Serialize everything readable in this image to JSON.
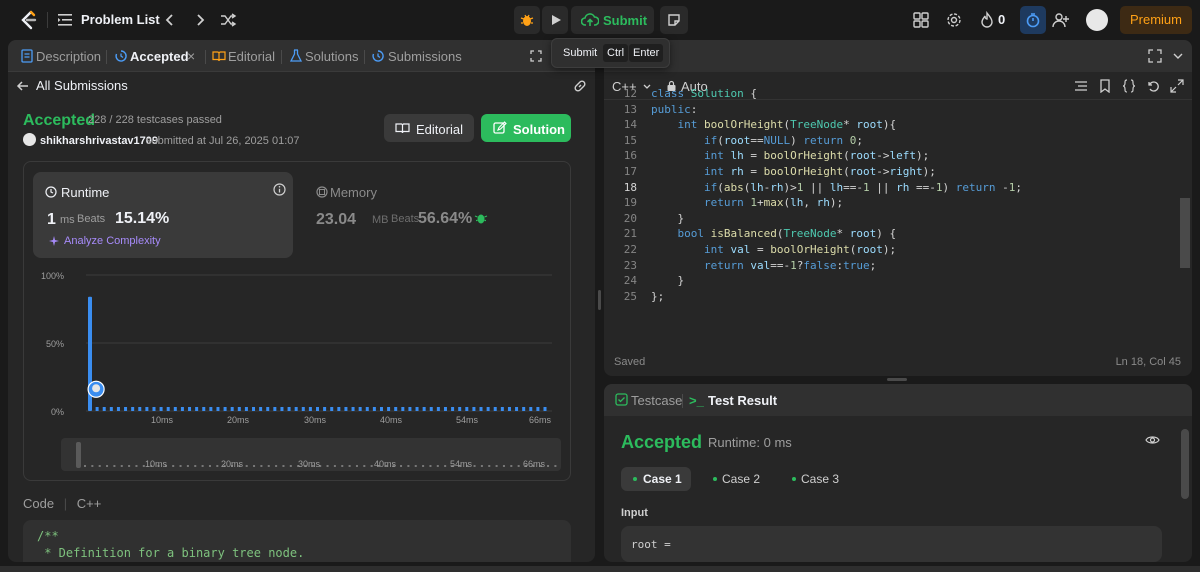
{
  "topbar": {
    "title": "Problem List",
    "submit_label": "Submit",
    "count": "0",
    "premium_label": "Premium"
  },
  "tooltip": {
    "label": "Submit",
    "key1": "Ctrl",
    "key2": "Enter"
  },
  "left_tabs": {
    "description": "Description",
    "accepted": "Accepted",
    "editorial": "Editorial",
    "solutions": "Solutions",
    "submissions": "Submissions"
  },
  "submission": {
    "back_label": "All Submissions",
    "status": "Accepted",
    "testcases": "228 / 228 testcases passed",
    "username": "shikharshrivastav1709",
    "meta": "submitted at Jul 26, 2025 01:07",
    "editorial_btn": "Editorial",
    "solution_btn": "Solution"
  },
  "runtime": {
    "label": "Runtime",
    "value": "1",
    "unit": "ms",
    "beats_label": "Beats",
    "beats_pct": "15.14%",
    "analyze": "Analyze Complexity"
  },
  "memory": {
    "label": "Memory",
    "value": "23.04",
    "unit": "MB",
    "beats_label": "Beats",
    "beats_pct": "56.64%"
  },
  "chart_data": {
    "type": "bar",
    "y_tick_labels": [
      "100%",
      "50%",
      "0%"
    ],
    "x_tick_labels": [
      "10ms",
      "20ms",
      "30ms",
      "40ms",
      "54ms",
      "66ms"
    ],
    "minimap_tick_labels": [
      "10ms",
      "20ms",
      "30ms",
      "40ms",
      "54ms",
      "66ms"
    ],
    "ylim": [
      0,
      100
    ],
    "values": [
      84,
      16,
      2,
      2,
      2,
      2,
      2,
      2,
      2,
      2,
      2,
      2,
      2,
      2,
      2,
      2,
      2,
      2,
      2,
      2,
      2,
      2,
      2,
      2,
      2,
      2,
      2,
      2,
      2,
      2,
      2,
      2,
      2,
      2,
      2,
      2,
      2,
      2,
      2,
      2,
      2,
      2,
      2,
      2,
      2,
      2,
      2,
      2,
      2,
      2,
      2,
      2,
      2,
      2,
      2,
      2,
      2,
      2,
      2,
      2,
      2,
      2,
      2,
      2,
      2
    ],
    "highlight_index": 1,
    "bar_color": "#3a8df0",
    "grid": true
  },
  "code_section": {
    "label": "Code",
    "lang": "C++",
    "lines": [
      "/**",
      " * Definition for a binary tree node."
    ]
  },
  "editor": {
    "lang": "C++",
    "mode": "Auto",
    "status_left": "Saved",
    "status_right": "Ln 18, Col 45",
    "lines": [
      {
        "n": "12",
        "t": "class Solution {"
      },
      {
        "n": "13",
        "t": "public:"
      },
      {
        "n": "14",
        "t": "    int boolOrHeight(TreeNode* root){"
      },
      {
        "n": "15",
        "t": "        if(root==NULL) return 0;"
      },
      {
        "n": "16",
        "t": "        int lh = boolOrHeight(root->left);"
      },
      {
        "n": "17",
        "t": "        int rh = boolOrHeight(root->right);"
      },
      {
        "n": "18",
        "t": "        if(abs(lh-rh)>1 || lh==-1 || rh ==-1) return -1;"
      },
      {
        "n": "19",
        "t": "        return 1+max(lh, rh);"
      },
      {
        "n": "20",
        "t": "    }"
      },
      {
        "n": "21",
        "t": "    bool isBalanced(TreeNode* root) {"
      },
      {
        "n": "22",
        "t": "        int val = boolOrHeight(root);"
      },
      {
        "n": "23",
        "t": "        return val==-1?false:true;"
      },
      {
        "n": "24",
        "t": "    }"
      },
      {
        "n": "25",
        "t": "};"
      }
    ]
  },
  "result": {
    "tab_testcase": "Testcase",
    "tab_result": "Test Result",
    "status": "Accepted",
    "runtime": "Runtime: 0 ms",
    "cases": [
      "Case 1",
      "Case 2",
      "Case 3"
    ],
    "input_label": "Input",
    "input_value": "root ="
  }
}
